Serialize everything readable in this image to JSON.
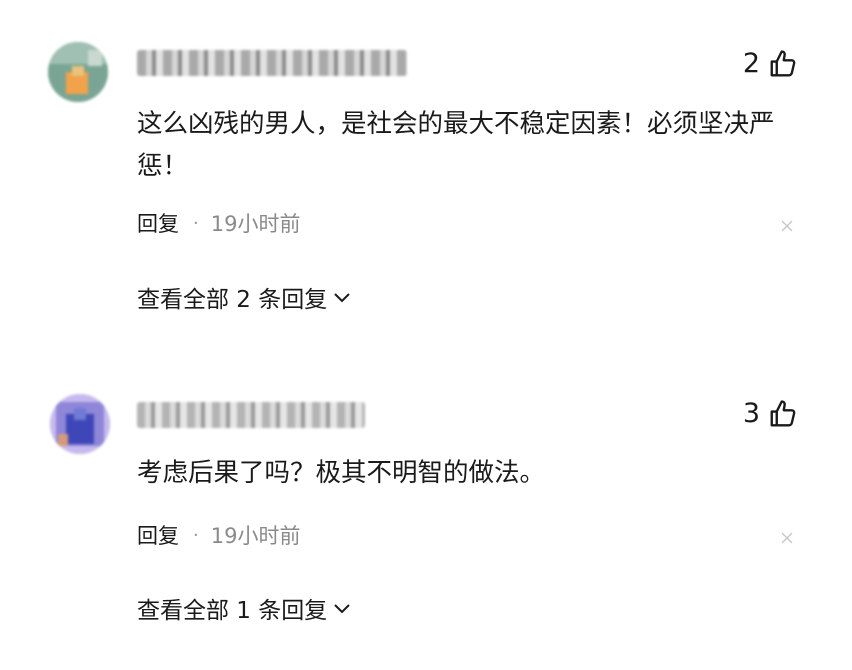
{
  "comments": [
    {
      "likes": "2",
      "text": "这么凶残的男人，是社会的最大不稳定因素！必须坚决严惩！",
      "reply_label": "回复",
      "separator": "·",
      "time": "19小时前",
      "view_replies": "查看全部 2 条回复"
    },
    {
      "likes": "3",
      "text": "考虑后果了吗？极其不明智的做法。",
      "reply_label": "回复",
      "separator": "·",
      "time": "19小时前",
      "view_replies": "查看全部 1 条回复"
    }
  ],
  "icons": {
    "like": "thumb-up-icon",
    "dismiss": "close-icon",
    "expand": "chevron-down-icon"
  },
  "colors": {
    "text": "#1a1a1a",
    "muted": "#8a8a8a",
    "background": "#ffffff"
  }
}
